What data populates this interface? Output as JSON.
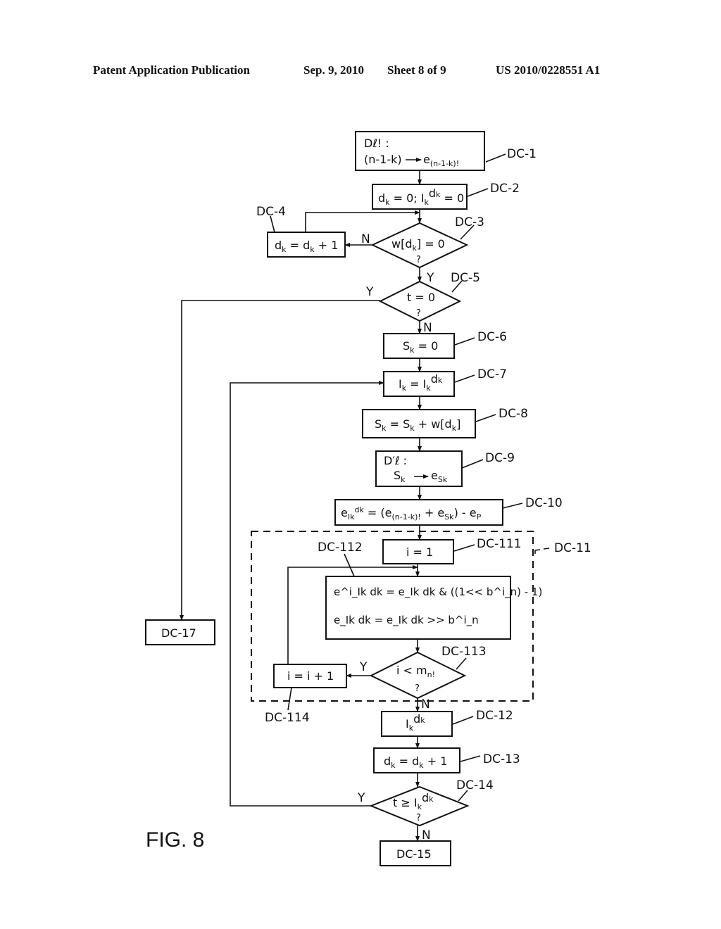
{
  "header": {
    "publication": "Patent Application Publication",
    "date": "Sep. 9, 2010",
    "sheet": "Sheet 8 of 9",
    "number": "US 2010/0228551 A1"
  },
  "figure_label": "FIG. 8",
  "steps": {
    "dc1": {
      "ref": "DC-1",
      "line1": "Dℓ! :",
      "line2a": "(n-1-k)",
      "line2b": "e",
      "line2sub": "(n-1-k)!"
    },
    "dc2": {
      "ref": "DC-2",
      "text": "d",
      "sub1": "k",
      "mid": " = 0; I",
      "sub2": "k",
      "sup": "d",
      "supsub": "k",
      "end": " = 0"
    },
    "dc3": {
      "ref": "DC-3",
      "text": "w[d",
      "sub": "k",
      "end": "] = 0",
      "q": "?"
    },
    "dc4": {
      "ref": "DC-4",
      "text": "d",
      "sub": "k",
      "mid": " = d",
      "sub2": "k",
      "end": " + 1"
    },
    "dc5": {
      "ref": "DC-5",
      "text": "t = 0",
      "q": "?"
    },
    "dc6": {
      "ref": "DC-6",
      "text": "S",
      "sub": "k",
      "end": " = 0"
    },
    "dc7": {
      "ref": "DC-7",
      "text": "I",
      "sub": "k",
      "mid": " = I",
      "sub2": "k",
      "sup": "d",
      "supsub": "k"
    },
    "dc8": {
      "ref": "DC-8",
      "text": "S",
      "sub": "k",
      "mid": " = S",
      "sub2": "k",
      "end": " + w[d",
      "sub3": "k",
      "end2": "]"
    },
    "dc9": {
      "ref": "DC-9",
      "line1": "D′ℓ :",
      "text": "S",
      "sub": "k",
      "out": "e",
      "outsub": "Sk"
    },
    "dc10": {
      "ref": "DC-10",
      "text": "e",
      "sub": "Ik",
      "sup": "dk",
      "rhs": " = (e",
      "rhs_sub1": "(n-1-k)!",
      "rhs_mid": " + e",
      "rhs_sub2": "Sk",
      "rhs_end": ") - e",
      "rhs_sub3": "P"
    },
    "dc11": {
      "ref": "DC-11"
    },
    "dc111": {
      "ref": "DC-111",
      "text": "i = 1"
    },
    "dc112": {
      "ref": "DC-112",
      "line1": "e^i_Ik dk = e_Ik dk & ((1<< b^i_n) - 1)",
      "line2": "e_Ik dk = e_Ik dk >> b^i_n"
    },
    "dc113": {
      "ref": "DC-113",
      "text": "i < m",
      "sub": "n!",
      "q": "?"
    },
    "dc114": {
      "ref": "DC-114",
      "text": "i = i + 1"
    },
    "dc12": {
      "ref": "DC-12",
      "text": "I",
      "sub": "k",
      "sup": "d",
      "supsub": "k"
    },
    "dc13": {
      "ref": "DC-13",
      "text": "d",
      "sub": "k",
      "mid": " = d",
      "sub2": "k",
      "end": " + 1"
    },
    "dc14": {
      "ref": "DC-14",
      "text": "t ≥ I",
      "sub": "k",
      "sup": "d",
      "supsub": "k",
      "q": "?"
    },
    "dc15": {
      "ref": "DC-15"
    },
    "dc17": {
      "ref": "DC-17"
    }
  },
  "branch_labels": {
    "yes": "Y",
    "no": "N"
  }
}
